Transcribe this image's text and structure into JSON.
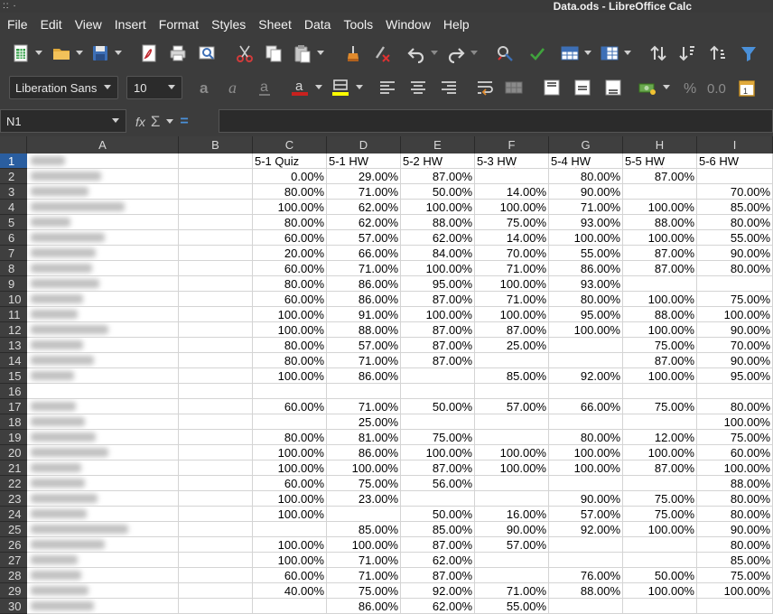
{
  "window": {
    "title": "Data.ods - LibreOffice Calc",
    "left_glyph": "::  ·"
  },
  "menu": [
    "File",
    "Edit",
    "View",
    "Insert",
    "Format",
    "Styles",
    "Sheet",
    "Data",
    "Tools",
    "Window",
    "Help"
  ],
  "toolbar1_icons": [
    "new-document-icon",
    "open-folder-icon",
    "save-icon",
    "export-pdf-icon",
    "print-icon",
    "print-preview-icon",
    "cut-icon",
    "copy-icon",
    "paste-icon",
    "clone-formatting-icon",
    "clear-formatting-icon",
    "undo-icon",
    "redo-icon",
    "spellcheck-icon",
    "autocorrect-check-icon",
    "insert-row-icon",
    "insert-column-icon",
    "sort-icon",
    "sort-ascending-icon",
    "sort-descending-icon",
    "autofilter-icon"
  ],
  "toolbar2_icons": [
    "bold-icon",
    "italic-icon",
    "underline-icon",
    "font-color-icon",
    "highlight-color-icon",
    "align-left-icon",
    "align-center-icon",
    "align-right-icon",
    "wrap-text-icon",
    "merge-cells-icon",
    "align-top-icon",
    "align-middle-icon",
    "align-bottom-icon",
    "currency-format-icon",
    "percent-format-icon",
    "decimal-format-icon",
    "date-format-icon"
  ],
  "format": {
    "font_name": "Liberation Sans",
    "font_size": "10",
    "font_color": "#c9211e",
    "highlight_color": "#ffff00"
  },
  "formula_bar": {
    "name_box": "N1",
    "fx": "fx",
    "sum": "Σ",
    "equals": "=",
    "content": ""
  },
  "columns": [
    "A",
    "B",
    "C",
    "D",
    "E",
    "F",
    "G",
    "H",
    "I"
  ],
  "header_row": [
    "",
    "",
    "5-1 Quiz",
    "5-1 HW",
    "5-2 HW",
    "5-3 HW",
    "5-4 HW",
    "5-5 HW",
    "5-6 HW"
  ],
  "rows": [
    {
      "n": "1"
    },
    {
      "n": "2",
      "v": [
        "0.00%",
        "29.00%",
        "87.00%",
        "",
        "80.00%",
        "87.00%",
        ""
      ]
    },
    {
      "n": "3",
      "v": [
        "80.00%",
        "71.00%",
        "50.00%",
        "14.00%",
        "90.00%",
        "",
        "70.00%"
      ]
    },
    {
      "n": "4",
      "v": [
        "100.00%",
        "62.00%",
        "100.00%",
        "100.00%",
        "71.00%",
        "100.00%",
        "85.00%"
      ]
    },
    {
      "n": "5",
      "v": [
        "80.00%",
        "62.00%",
        "88.00%",
        "75.00%",
        "93.00%",
        "88.00%",
        "80.00%"
      ]
    },
    {
      "n": "6",
      "v": [
        "60.00%",
        "57.00%",
        "62.00%",
        "14.00%",
        "100.00%",
        "100.00%",
        "55.00%"
      ]
    },
    {
      "n": "7",
      "v": [
        "20.00%",
        "66.00%",
        "84.00%",
        "70.00%",
        "55.00%",
        "87.00%",
        "90.00%"
      ]
    },
    {
      "n": "8",
      "v": [
        "60.00%",
        "71.00%",
        "100.00%",
        "71.00%",
        "86.00%",
        "87.00%",
        "80.00%"
      ]
    },
    {
      "n": "9",
      "v": [
        "80.00%",
        "86.00%",
        "95.00%",
        "100.00%",
        "93.00%",
        "",
        ""
      ]
    },
    {
      "n": "10",
      "v": [
        "60.00%",
        "86.00%",
        "87.00%",
        "71.00%",
        "80.00%",
        "100.00%",
        "75.00%"
      ]
    },
    {
      "n": "11",
      "v": [
        "100.00%",
        "91.00%",
        "100.00%",
        "100.00%",
        "95.00%",
        "88.00%",
        "100.00%"
      ]
    },
    {
      "n": "12",
      "v": [
        "100.00%",
        "88.00%",
        "87.00%",
        "87.00%",
        "100.00%",
        "100.00%",
        "90.00%"
      ]
    },
    {
      "n": "13",
      "v": [
        "80.00%",
        "57.00%",
        "87.00%",
        "25.00%",
        "",
        "75.00%",
        "70.00%"
      ]
    },
    {
      "n": "14",
      "v": [
        "80.00%",
        "71.00%",
        "87.00%",
        "",
        "",
        "87.00%",
        "90.00%"
      ]
    },
    {
      "n": "15",
      "v": [
        "100.00%",
        "86.00%",
        "",
        "85.00%",
        "92.00%",
        "100.00%",
        "95.00%"
      ]
    },
    {
      "n": "16",
      "v": [
        "",
        "",
        "",
        "",
        "",
        "",
        ""
      ]
    },
    {
      "n": "17",
      "v": [
        "60.00%",
        "71.00%",
        "50.00%",
        "57.00%",
        "66.00%",
        "75.00%",
        "80.00%"
      ]
    },
    {
      "n": "18",
      "v": [
        "",
        "25.00%",
        "",
        "",
        "",
        "",
        "100.00%"
      ]
    },
    {
      "n": "19",
      "v": [
        "80.00%",
        "81.00%",
        "75.00%",
        "",
        "80.00%",
        "12.00%",
        "75.00%"
      ]
    },
    {
      "n": "20",
      "v": [
        "100.00%",
        "86.00%",
        "100.00%",
        "100.00%",
        "100.00%",
        "100.00%",
        "60.00%"
      ]
    },
    {
      "n": "21",
      "v": [
        "100.00%",
        "100.00%",
        "87.00%",
        "100.00%",
        "100.00%",
        "87.00%",
        "100.00%"
      ]
    },
    {
      "n": "22",
      "v": [
        "60.00%",
        "75.00%",
        "56.00%",
        "",
        "",
        "",
        "88.00%"
      ]
    },
    {
      "n": "23",
      "v": [
        "100.00%",
        "23.00%",
        "",
        "",
        "90.00%",
        "75.00%",
        "80.00%"
      ]
    },
    {
      "n": "24",
      "v": [
        "100.00%",
        "",
        "50.00%",
        "16.00%",
        "57.00%",
        "75.00%",
        "80.00%"
      ]
    },
    {
      "n": "25",
      "v": [
        "",
        "85.00%",
        "85.00%",
        "90.00%",
        "92.00%",
        "100.00%",
        "90.00%"
      ]
    },
    {
      "n": "26",
      "v": [
        "100.00%",
        "100.00%",
        "87.00%",
        "57.00%",
        "",
        "",
        "80.00%"
      ]
    },
    {
      "n": "27",
      "v": [
        "100.00%",
        "71.00%",
        "62.00%",
        "",
        "",
        "",
        "85.00%"
      ]
    },
    {
      "n": "28",
      "v": [
        "60.00%",
        "71.00%",
        "87.00%",
        "",
        "76.00%",
        "50.00%",
        "75.00%"
      ]
    },
    {
      "n": "29",
      "v": [
        "40.00%",
        "75.00%",
        "92.00%",
        "71.00%",
        "88.00%",
        "100.00%",
        "100.00%"
      ]
    },
    {
      "n": "30",
      "v": [
        "",
        "86.00%",
        "62.00%",
        "55.00%",
        "",
        "",
        ""
      ]
    }
  ],
  "colors": {
    "chrome": "#3c3c3c",
    "selected_row_header": "#2a5ea0",
    "spell_underline": "#d00000"
  }
}
